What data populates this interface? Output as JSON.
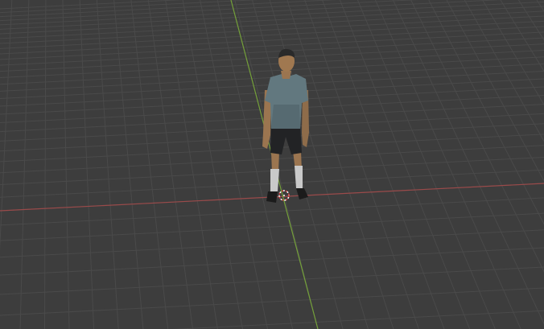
{
  "viewport": {
    "background": "#3d3d3d",
    "grid_color": "#4a4a4a",
    "x_axis_color": "#9a4a4a",
    "y_axis_color": "#74a03a"
  },
  "scene": {
    "object": "character-model",
    "cursor_icon": "3d-cursor-icon",
    "colors": {
      "shirt": "#62787f",
      "shorts": "#222325",
      "skin": "#a07850",
      "hair": "#2a2a2a",
      "socks": "#c9c9c9",
      "shoes": "#1b1b1b"
    }
  }
}
